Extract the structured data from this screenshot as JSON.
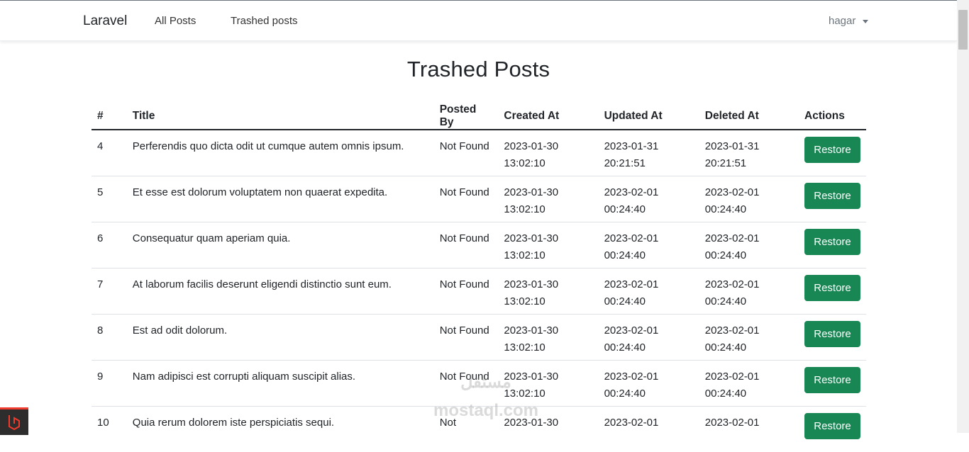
{
  "navbar": {
    "brand": "Laravel",
    "links": [
      "All Posts",
      "Trashed posts"
    ],
    "user": "hagar"
  },
  "page": {
    "title": "Trashed Posts"
  },
  "table": {
    "headers": [
      "#",
      "Title",
      "Posted By",
      "Created At",
      "Updated At",
      "Deleted At",
      "Actions"
    ],
    "action_label": "Restore",
    "rows": [
      {
        "id": "4",
        "title": "Perferendis quo dicta odit ut cumque autem omnis ipsum.",
        "posted_by": "Not Found",
        "created": "2023-01-30 13:02:10",
        "updated": "2023-01-31 20:21:51",
        "deleted": "2023-01-31 20:21:51"
      },
      {
        "id": "5",
        "title": "Et esse est dolorum voluptatem non quaerat expedita.",
        "posted_by": "Not Found",
        "created": "2023-01-30 13:02:10",
        "updated": "2023-02-01 00:24:40",
        "deleted": "2023-02-01 00:24:40"
      },
      {
        "id": "6",
        "title": "Consequatur quam aperiam quia.",
        "posted_by": "Not Found",
        "created": "2023-01-30 13:02:10",
        "updated": "2023-02-01 00:24:40",
        "deleted": "2023-02-01 00:24:40"
      },
      {
        "id": "7",
        "title": "At laborum facilis deserunt eligendi distinctio sunt eum.",
        "posted_by": "Not Found",
        "created": "2023-01-30 13:02:10",
        "updated": "2023-02-01 00:24:40",
        "deleted": "2023-02-01 00:24:40"
      },
      {
        "id": "8",
        "title": "Est ad odit dolorum.",
        "posted_by": "Not Found",
        "created": "2023-01-30 13:02:10",
        "updated": "2023-02-01 00:24:40",
        "deleted": "2023-02-01 00:24:40"
      },
      {
        "id": "9",
        "title": "Nam adipisci est corrupti aliquam suscipit alias.",
        "posted_by": "Not Found",
        "created": "2023-01-30 13:02:10",
        "updated": "2023-02-01 00:24:40",
        "deleted": "2023-02-01 00:24:40"
      },
      {
        "id": "10",
        "title": "Quia rerum dolorem iste perspiciatis sequi.",
        "posted_by": "Not",
        "created": "2023-01-30",
        "updated": "2023-02-01",
        "deleted": "2023-02-01"
      }
    ]
  },
  "watermark": {
    "text": "مستقل mostaql.com"
  },
  "colors": {
    "button": "#198754",
    "logo_accent": "#ef3b2d"
  }
}
